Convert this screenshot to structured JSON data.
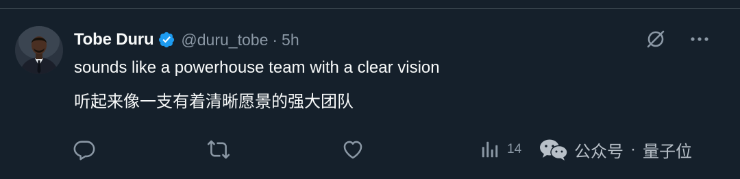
{
  "post": {
    "author": {
      "name": "Tobe Duru",
      "handle": "@duru_tobe",
      "verified": true
    },
    "separator": "·",
    "time": "5h",
    "text": "sounds like a powerhouse team with a clear vision",
    "translation": "听起来像一支有着清晰愿景的强大团队",
    "header_icons": [
      "grok-icon",
      "more-icon"
    ],
    "actions": {
      "reply": {
        "icon": "reply-icon",
        "count": ""
      },
      "repost": {
        "icon": "repost-icon",
        "count": ""
      },
      "like": {
        "icon": "like-icon",
        "count": ""
      },
      "views": {
        "icon": "views-icon",
        "count": "14"
      }
    }
  },
  "watermark": {
    "icon": "wechat-icon",
    "source": "公众号",
    "separator": "·",
    "name": "量子位"
  },
  "colors": {
    "background": "#15202b",
    "primary_text": "#f7f9f9",
    "secondary_text": "#8b98a5",
    "verified_badge": "#1d9bf0",
    "divider": "#38444d"
  }
}
